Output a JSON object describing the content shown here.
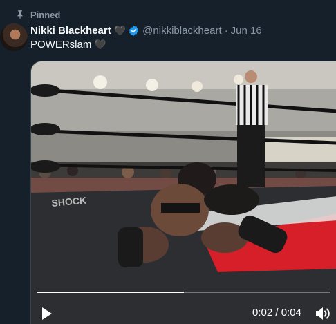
{
  "pinned": {
    "label": "Pinned",
    "icon": "pin-icon"
  },
  "author": {
    "display_name": "Nikki Blackheart",
    "name_emoji": "🖤",
    "verified_icon": "verified-badge-icon",
    "handle": "@nikkiblackheart",
    "separator": "·",
    "date": "Jun 16"
  },
  "tweet": {
    "text": "POWERslam",
    "emoji": "🖤"
  },
  "video": {
    "current_time": "0:02",
    "time_separator": " / ",
    "duration": "0:04",
    "progress": 0.5,
    "play_icon": "play-icon",
    "volume_icon": "volume-icon"
  },
  "colors": {
    "background": "#15202b",
    "secondary_text": "#8b98a5",
    "accent": "#1d9bf0"
  }
}
